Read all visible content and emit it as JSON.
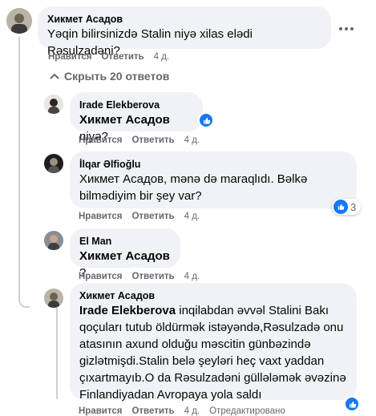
{
  "labels": {
    "like": "Нравится",
    "reply": "Ответить",
    "edited": "Отредактировано"
  },
  "hide_replies": "Скрыть 20 ответов",
  "comments": [
    {
      "author": "Хикмет Асадов",
      "text": "Yəqin bilirsinizdə Stalin niyə xilas elədi Rəsulzadəni?",
      "time": "4 д."
    },
    {
      "author": "Irade Elekberova",
      "mention": "Хикмет Асадов",
      "text": " niyə?",
      "time": "4 д."
    },
    {
      "author": "İlqar Əlfioğlu",
      "text": "Хикмет Асадов, mənə də maraqlıdı. Bəlkə bilmədiyim bir şey var?",
      "time": "4 д.",
      "reaction_count": "3"
    },
    {
      "author": "El Man",
      "mention": "Хикмет Асадов",
      "text": " ?",
      "time": "4 д."
    },
    {
      "author": "Хикмет Асадов",
      "mention": "Irade Elekberova",
      "text": " inqilabdan əvvəl Stalini Bakı qoçuları tutub öldürmək istəyəndə,Rəsulzadə onu atasının axund olduğu məscitin günbəzində gizlətmişdi.Stalin belə şeyləri heç vaxt yaddan çıxartmayıb.O da Rəsulzadəni güllələmək əvəzinə Finlandiyadan Avropaya yola saldı",
      "time": "4 д."
    }
  ],
  "colors": {
    "bubble": "#f0f2f5",
    "like_blue": "#1877f2",
    "meta_gray": "#65676b"
  }
}
